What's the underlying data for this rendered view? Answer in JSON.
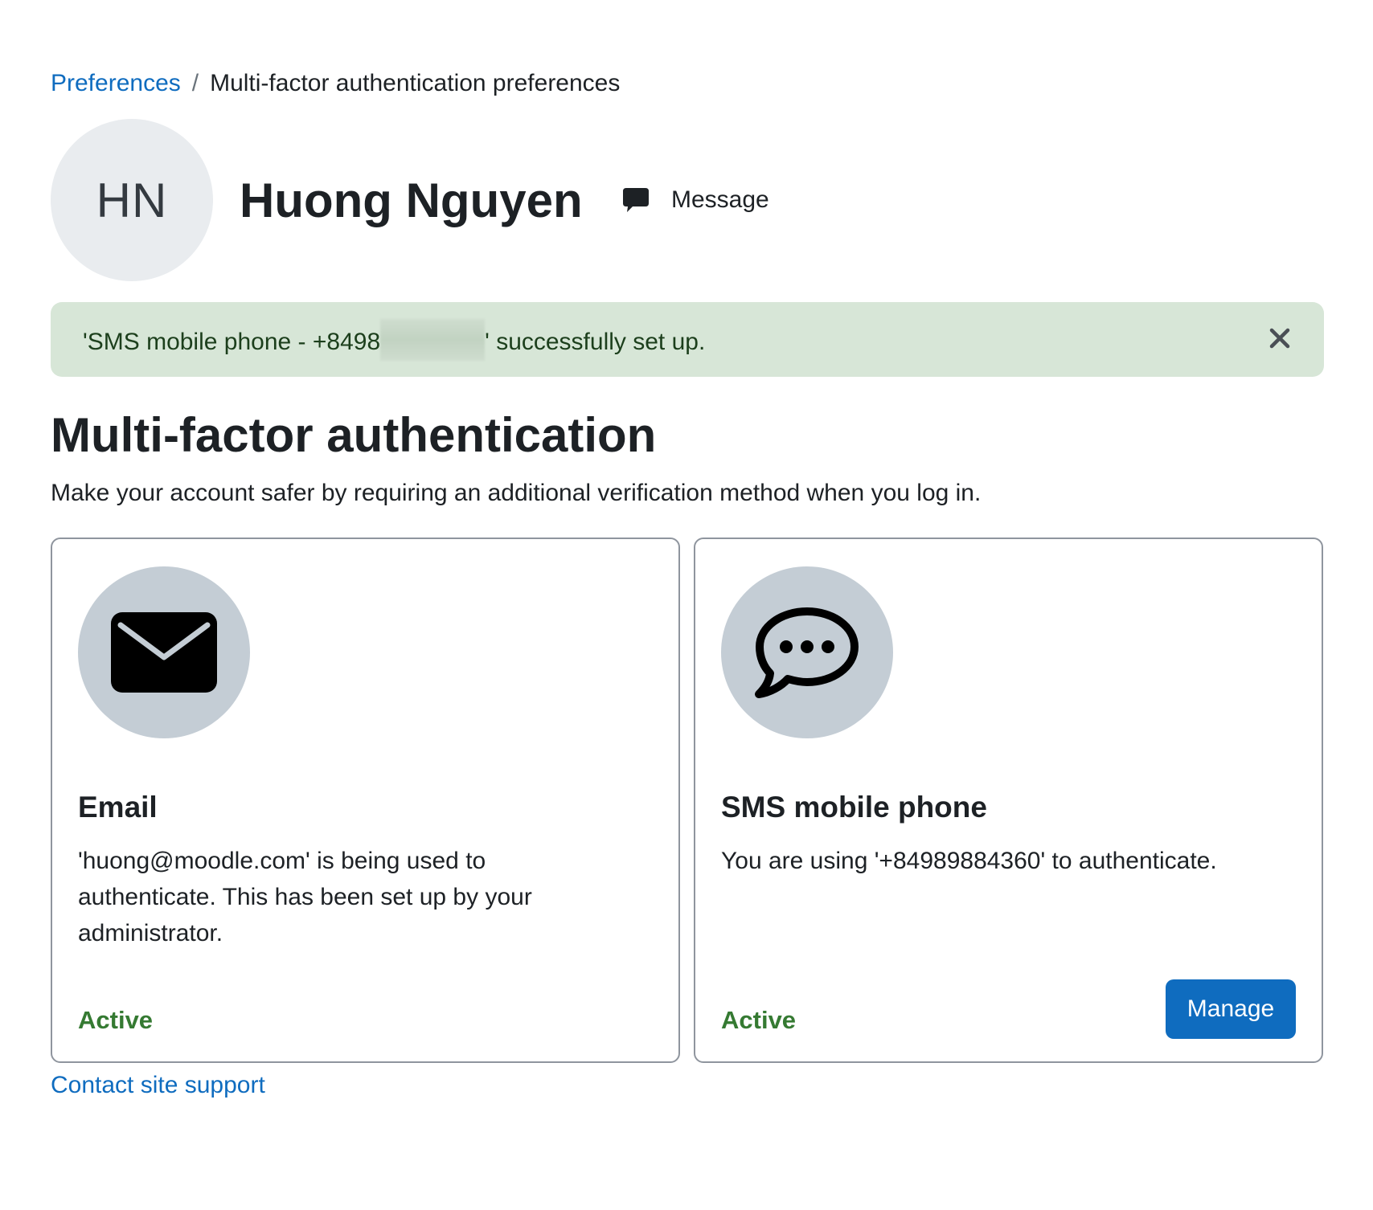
{
  "breadcrumb": {
    "parent_label": "Preferences",
    "separator": "/",
    "current_label": "Multi-factor authentication preferences"
  },
  "profile": {
    "initials": "HN",
    "name": "Huong Nguyen",
    "message_label": "Message",
    "message_icon": "speech-bubble-icon"
  },
  "alert": {
    "text_prefix": "'SMS mobile phone - +8498",
    "text_suffix": "' successfully set up.",
    "close_icon": "close-icon",
    "background_color": "#d7e6d7"
  },
  "section": {
    "title": "Multi-factor authentication",
    "description": "Make your account safer by requiring an additional verification method when you log in."
  },
  "factors": [
    {
      "icon": "envelope-icon",
      "title": "Email",
      "description": "'huong@moodle.com' is being used to authenticate. This has been set up by your administrator.",
      "status": "Active"
    },
    {
      "icon": "sms-chat-icon",
      "title": "SMS mobile phone",
      "description": "You are using '+84989884360' to authenticate.",
      "status": "Active",
      "action_label": "Manage"
    }
  ],
  "footer": {
    "support_link": "Contact site support"
  },
  "colors": {
    "link": "#0f6cbf",
    "status_active": "#357a32",
    "primary_button": "#0f6cbf",
    "icon_circle": "#c4cdd5",
    "avatar_bg": "#e9ecef"
  }
}
